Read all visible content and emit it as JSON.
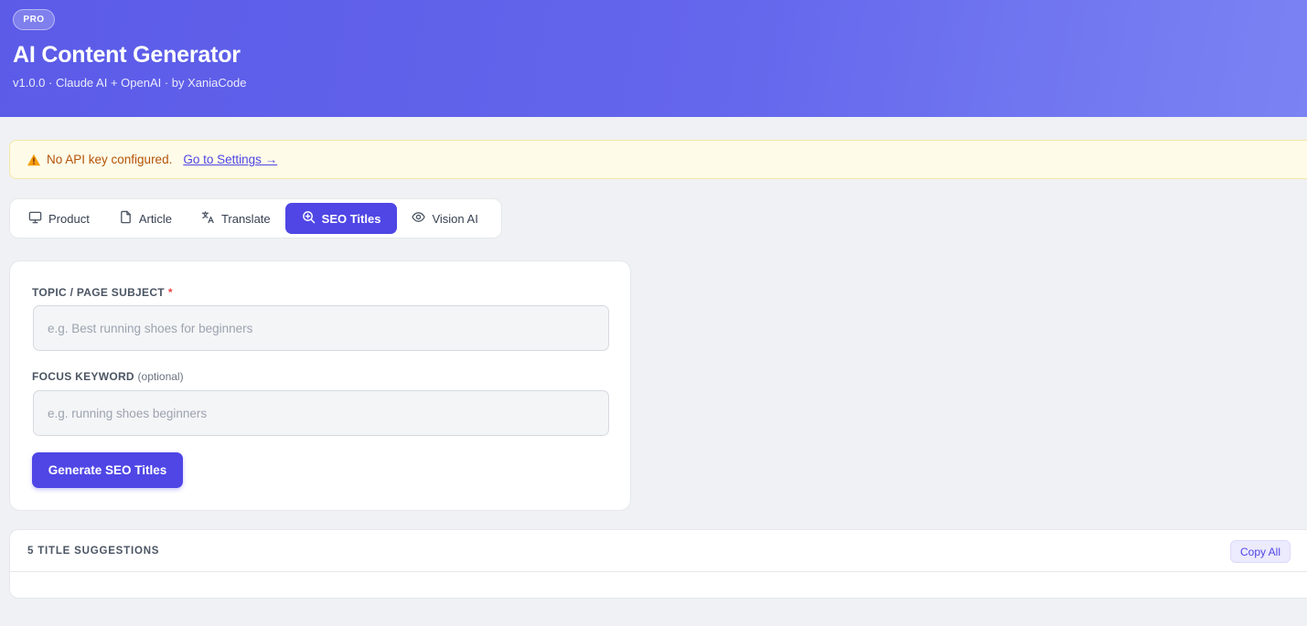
{
  "header": {
    "badge": "PRO",
    "title": "AI Content Generator",
    "subtitle": "v1.0.0 · Claude AI + OpenAI · by XaniaCode"
  },
  "alert": {
    "message": "No API key configured.",
    "link": "Go to Settings →",
    "icon": "warning-icon"
  },
  "tabs": [
    {
      "label": "Product",
      "icon": "monitor-icon"
    },
    {
      "label": "Article",
      "icon": "document-icon"
    },
    {
      "label": "Translate",
      "icon": "translate-icon"
    },
    {
      "label": "SEO Titles",
      "icon": "search-zoom-icon",
      "active": true
    },
    {
      "label": "Vision AI",
      "icon": "eye-icon"
    }
  ],
  "form": {
    "topic_label": "TOPIC / PAGE SUBJECT",
    "topic_required": "*",
    "topic_placeholder": "e.g. Best running shoes for beginners",
    "keyword_label": "FOCUS KEYWORD",
    "keyword_optional": "(optional)",
    "keyword_placeholder": "e.g. running shoes beginners",
    "submit_label": "Generate SEO Titles"
  },
  "results": {
    "title": "5 TITLE SUGGESTIONS",
    "copy_label": "Copy All"
  },
  "colors": {
    "accent": "#4f46e5",
    "header_start": "#5b5be8",
    "header_end": "#7b83f3",
    "warning_text": "#b45309",
    "warning_bg": "#fefbe8"
  }
}
